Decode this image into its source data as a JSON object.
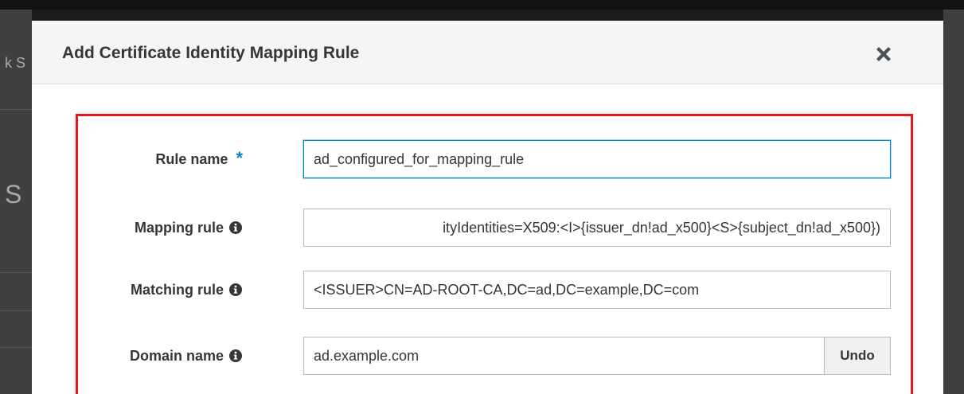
{
  "background": {
    "fragment_text": "k S",
    "fragment_big": "S"
  },
  "dialog": {
    "title": "Add Certificate Identity Mapping Rule",
    "close_icon": "close-icon"
  },
  "form": {
    "rule_name": {
      "label": "Rule name",
      "required_marker": "*",
      "value": "ad_configured_for_mapping_rule"
    },
    "mapping_rule": {
      "label": "Mapping rule",
      "info_icon": "info-icon",
      "value": "ityIdentities=X509:<I>{issuer_dn!ad_x500}<S>{subject_dn!ad_x500})"
    },
    "matching_rule": {
      "label": "Matching rule",
      "info_icon": "info-icon",
      "value": "<ISSUER>CN=AD-ROOT-CA,DC=ad,DC=example,DC=com"
    },
    "domain_name": {
      "label": "Domain name",
      "info_icon": "info-icon",
      "value": "ad.example.com",
      "undo_label": "Undo"
    }
  },
  "colors": {
    "highlight": "#e8171e",
    "required": "#0088ce",
    "focus": "#0088ce"
  }
}
